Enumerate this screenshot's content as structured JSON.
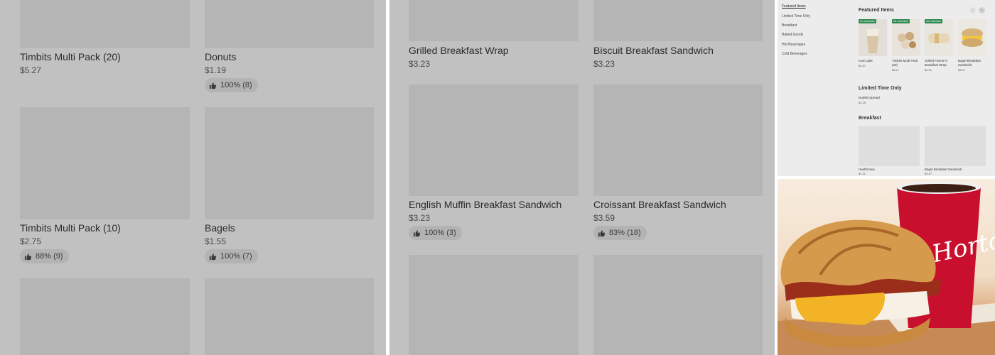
{
  "left_panel": {
    "items": [
      {
        "name": "Timbits Multi Pack (20)",
        "price": "$5.27"
      },
      {
        "name": "Donuts",
        "price": "$1.19",
        "rating": "100% (8)"
      },
      {
        "name": "Timbits Multi Pack (10)",
        "price": "$2.75",
        "rating": "88% (9)"
      },
      {
        "name": "Bagels",
        "price": "$1.55",
        "rating": "100% (7)"
      }
    ]
  },
  "middle_panel": {
    "items": [
      {
        "name": "Grilled Breakfast Wrap",
        "price": "$3.23"
      },
      {
        "name": "Biscuit Breakfast Sandwich",
        "price": "$3.23"
      },
      {
        "name": "English Muffin Breakfast Sandwich",
        "price": "$3.23",
        "rating": "100% (3)"
      },
      {
        "name": "Croissant Breakfast Sandwich",
        "price": "$3.59",
        "rating": "83% (18)"
      }
    ]
  },
  "menu_panel": {
    "categories": [
      "Featured Items",
      "Limited Time Only",
      "Breakfast",
      "Baked Goods",
      "Hot Beverages",
      "Cold Beverages"
    ],
    "featured": {
      "title": "Featured Items",
      "items": [
        {
          "badge": "#1 most liked",
          "name": "Iced Latte",
          "price": "$2.87"
        },
        {
          "badge": "#2 most liked",
          "name": "Timbits Multi Pack (20)",
          "price": "$5.27"
        },
        {
          "badge": "#3 most liked",
          "name": "Grilled Farmer's Breakfast Wrap",
          "price": "$4.31"
        },
        {
          "name": "Bagel Breakfast Sandwich",
          "price": "$3.47"
        }
      ]
    },
    "limited": {
      "title": "Limited Time Only",
      "item_name": "Nutella Spread",
      "item_price": "$1.25"
    },
    "breakfast": {
      "title": "Breakfast",
      "items": [
        {
          "name": "Hashbrown",
          "price": "$1.31"
        },
        {
          "name": "Bagel Breakfast Sandwich",
          "price": "$3.47"
        }
      ]
    },
    "nav": {
      "prev": "‹",
      "next": "›"
    }
  },
  "photo": {
    "brand_text": "Tim Horto",
    "cup_color": "#c8102e",
    "coffee_color": "#3b1f14"
  }
}
